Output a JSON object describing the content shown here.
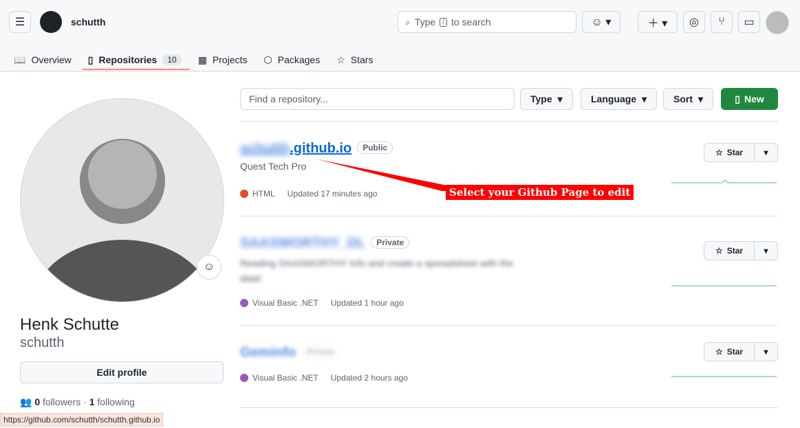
{
  "header": {
    "username": "schutth",
    "search_placeholder_prefix": "Type",
    "search_key": "/",
    "search_placeholder_suffix": "to search"
  },
  "tabs": [
    {
      "label": "Overview"
    },
    {
      "label": "Repositories",
      "count": "10"
    },
    {
      "label": "Projects"
    },
    {
      "label": "Packages"
    },
    {
      "label": "Stars"
    }
  ],
  "profile": {
    "full_name": "Henk Schutte",
    "login": "schutth",
    "edit_label": "Edit profile",
    "followers": "0",
    "followers_label": "followers",
    "following": "1",
    "following_label": "following"
  },
  "toolbar": {
    "find_placeholder": "Find a repository...",
    "type": "Type",
    "language": "Language",
    "sort": "Sort",
    "new": "New"
  },
  "repos": [
    {
      "name_prefix": "schutth",
      "name_suffix": ".github.io",
      "visibility": "Public",
      "description": "Quest Tech Pro",
      "language": "HTML",
      "lang_color": "#e34c26",
      "updated": "Updated 17 minutes ago",
      "star": "Star"
    },
    {
      "name_prefix": "SAASWORTHY_DL",
      "name_suffix": "",
      "visibility": "Private",
      "description": "Reading SAASWORTHY Info and create a spreadsheet with the data!",
      "language": "Visual Basic .NET",
      "lang_color": "#945db7",
      "updated": "Updated 1 hour ago",
      "star": "Star"
    },
    {
      "name_prefix": "Geminfo",
      "name_suffix": "",
      "visibility": "Private",
      "description": "",
      "language": "Visual Basic .NET",
      "lang_color": "#945db7",
      "updated": "Updated 2 hours ago",
      "star": "Star"
    }
  ],
  "annotation": "Select your Github Page to edit",
  "status_bar": "https://github.com/schutth/schutth.github.io"
}
